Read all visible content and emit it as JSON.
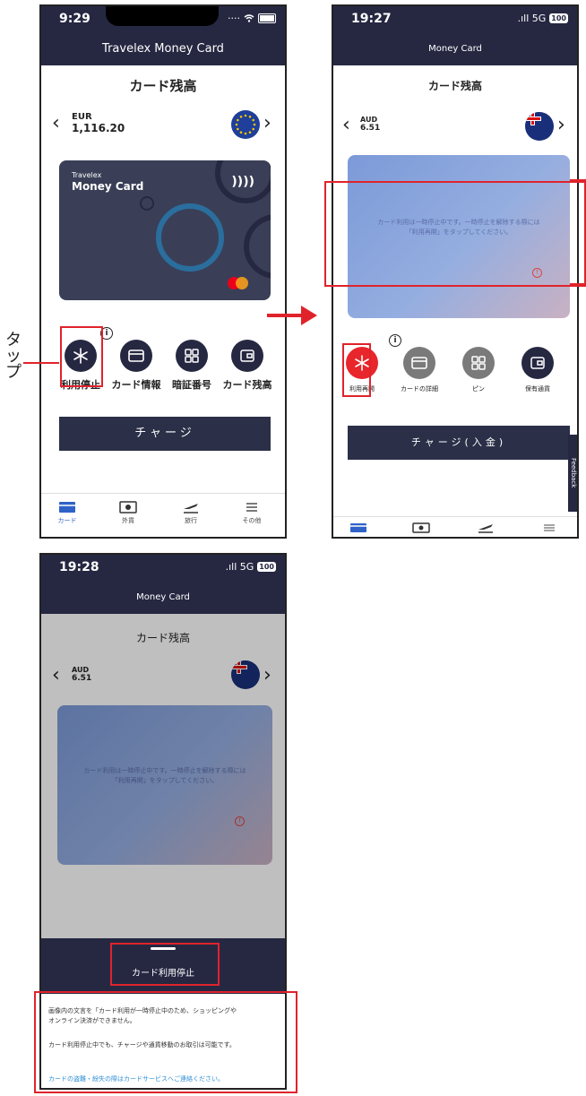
{
  "annotation": {
    "tap_label": "タップ",
    "highlight_color": "#e0232b"
  },
  "screen1": {
    "time": "9:29",
    "title": "Travelex Money Card",
    "heading": "カード残高",
    "currency_code": "EUR",
    "balance": "1,116.20",
    "card_brand_small": "Travelex",
    "card_brand_large": "Money Card",
    "contactless": "))))",
    "info": "i",
    "actions": [
      {
        "label": "利用停止",
        "icon": "snowflake-icon"
      },
      {
        "label": "カード情報",
        "icon": "card-icon"
      },
      {
        "label": "暗証番号",
        "icon": "keypad-icon"
      },
      {
        "label": "カード残高",
        "icon": "wallet-icon"
      }
    ],
    "charge_label": "チャージ",
    "tabs": [
      {
        "label": "カード",
        "icon": "card-tab-icon"
      },
      {
        "label": "外貨",
        "icon": "money-tab-icon"
      },
      {
        "label": "旅行",
        "icon": "plane-tab-icon"
      },
      {
        "label": "その他",
        "icon": "menu-tab-icon"
      }
    ]
  },
  "screen2": {
    "time": "19:27",
    "signal": ".ıll 5G",
    "battery": "100",
    "title": "Money Card",
    "heading": "カード残高",
    "currency_code": "AUD",
    "balance": "6.51",
    "card_message_line1": "カード利用は一時停止中です。一時停止を解除する際には",
    "card_message_line2": "「利用再開」をタップしてください。",
    "info": "i",
    "actions": [
      {
        "label": "利用再開",
        "icon": "snowflake-icon"
      },
      {
        "label": "カードの詳細",
        "icon": "card-icon"
      },
      {
        "label": "ピン",
        "icon": "keypad-icon"
      },
      {
        "label": "保有通貨",
        "icon": "wallet-icon"
      }
    ],
    "charge_label": "チャージ(入金)",
    "feedback_label": "Feedback"
  },
  "screen3": {
    "time": "19:28",
    "signal": ".ıll 5G",
    "battery": "100",
    "title": "Money Card",
    "heading": "カード残高",
    "currency_code": "AUD",
    "balance": "6.51",
    "card_message_line1": "カード利用は一時停止中です。一時停止を解除する際には",
    "card_message_line2": "「利用再開」をタップしてください。",
    "sheet_title": "カード利用停止",
    "sheet_text_1a": "画像内の文言を「カード利用が一時停止中のため、ショッピングや",
    "sheet_text_1b": "オンライン決済ができません。",
    "sheet_text_2": "カード利用停止中でも、チャージや通貨移動のお取引は可能です。",
    "sheet_link": "カードの盗難・紛失の際はカードサービスへご連絡ください。"
  }
}
